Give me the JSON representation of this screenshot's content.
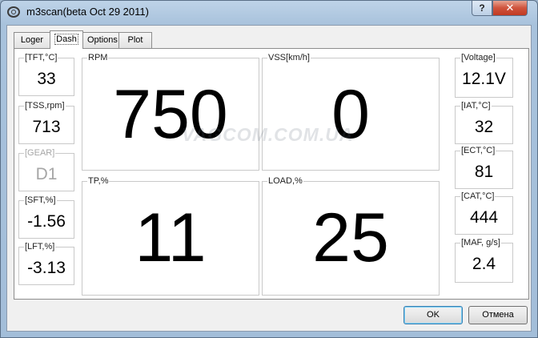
{
  "window": {
    "title": "m3scan(beta Oct 29 2011)",
    "help_label": "?",
    "close_label": "✕"
  },
  "tabs": [
    {
      "label": "Loger"
    },
    {
      "label": "Dash"
    },
    {
      "label": "Options"
    },
    {
      "label": "Plot"
    }
  ],
  "left_gauges": [
    {
      "label": "[TFT,°C]",
      "value": "33"
    },
    {
      "label": "[TSS,rpm]",
      "value": "713"
    },
    {
      "label": "[GEAR]",
      "value": "D1"
    },
    {
      "label": "[SFT,%]",
      "value": "-1.56"
    },
    {
      "label": "[LFT,%]",
      "value": "-3.13"
    }
  ],
  "big_gauges": [
    {
      "label": "RPM",
      "value": "750"
    },
    {
      "label": "VSS[km/h]",
      "value": "0"
    },
    {
      "label": "TP,%",
      "value": "11"
    },
    {
      "label": "LOAD,%",
      "value": "25"
    }
  ],
  "right_gauges": [
    {
      "label": "[Voltage]",
      "value": "12.1V"
    },
    {
      "label": "[IAT,°C]",
      "value": "32"
    },
    {
      "label": "[ECT,°C]",
      "value": "81"
    },
    {
      "label": "[CAT,°C]",
      "value": "444"
    },
    {
      "label": "[MAF, g/s]",
      "value": "2.4"
    }
  ],
  "watermark": {
    "text": "VAGCOM.COM.UA"
  },
  "buttons": {
    "ok_label": "OK",
    "cancel_label": "Отмена"
  }
}
